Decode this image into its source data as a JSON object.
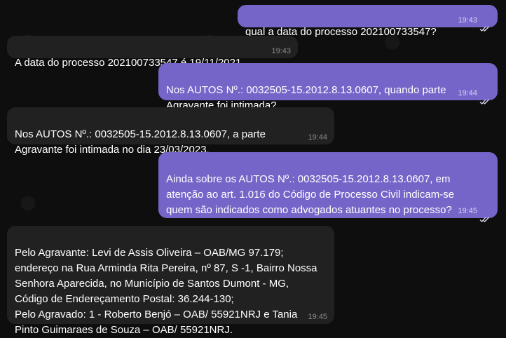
{
  "messages": [
    {
      "direction": "out",
      "text": "qual a data do processo 202100733547?",
      "time": "19:43",
      "status": "read"
    },
    {
      "direction": "in",
      "text": "A data do processo 202100733547 é 19/11/2021.",
      "time": "19:43"
    },
    {
      "direction": "out",
      "text": "Nos AUTOS Nº.: 0032505-15.2012.8.13.0607, quando  parte\nAgravante foi intimada?",
      "time": "19:44",
      "status": "read"
    },
    {
      "direction": "in",
      "text": "Nos AUTOS Nº.: 0032505-15.2012.8.13.0607, a parte\nAgravante foi intimada no dia 23/03/2023.",
      "time": "19:44"
    },
    {
      "direction": "out",
      "text": "Ainda sobre os AUTOS Nº.: 0032505-15.2012.8.13.0607, em\natenção ao art. 1.016 do Código de Processo Civil indicam-se\nquem são indicados como advogados atuantes no processo?",
      "time": "19:45",
      "status": "read"
    },
    {
      "direction": "in",
      "text": "Pelo Agravante: Levi de Assis Oliveira – OAB/MG 97.179;\nendereço na Rua Arminda Rita Pereira, nº 87, S -1, Bairro Nossa\nSenhora Aparecida, no Município de Santos Dumont - MG,\nCódigo de Endereçamento Postal: 36.244-130;\nPelo Agravado: 1 - Roberto Benjó – OAB/ 55921NRJ e Tania\nPinto Guimaraes de Souza – OAB/ 55921NRJ.",
      "time": "19:45"
    }
  ],
  "colors": {
    "outgoing_bubble": "#7665c8",
    "incoming_bubble": "#212121",
    "background": "#0e0e0e"
  },
  "icons": {
    "read_status": "double-check-icon"
  }
}
